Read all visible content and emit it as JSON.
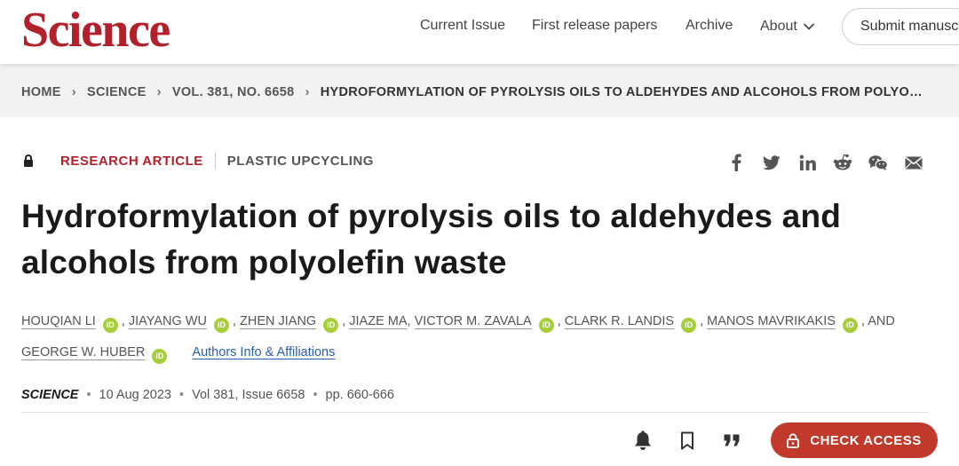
{
  "header": {
    "logo": "Science",
    "nav": [
      "Current Issue",
      "First release papers",
      "Archive",
      "About"
    ],
    "submit_label": "Submit manuscript"
  },
  "breadcrumb": [
    "HOME",
    "SCIENCE",
    "VOL. 381, NO. 6658",
    "HYDROFORMYLATION OF PYROLYSIS OILS TO ALDEHYDES AND ALCOHOLS FROM POLYOLEFIN WASTE"
  ],
  "article": {
    "type": "RESEARCH ARTICLE",
    "topic": "PLASTIC UPCYCLING",
    "title": "Hydroformylation of pyrolysis oils to aldehydes and alcohols from polyolefin waste",
    "authors": [
      "HOUQIAN LI",
      "JIAYANG WU",
      "ZHEN JIANG",
      "JIAZE MA",
      "VICTOR M. ZAVALA",
      "CLARK R. LANDIS",
      "MANOS MAVRIKAKIS",
      "GEORGE W. HUBER"
    ],
    "and_label": "AND",
    "orcid_label": "iD",
    "affiliations_link": "Authors Info & Affiliations",
    "journal": "SCIENCE",
    "date": "10 Aug 2023",
    "volume_issue": "Vol 381, Issue 6658",
    "pages": "pp. 660-666"
  },
  "share_icons": [
    "facebook-icon",
    "twitter-icon",
    "linkedin-icon",
    "reddit-icon",
    "wechat-icon",
    "email-icon"
  ],
  "actions": {
    "check_access": "CHECK ACCESS"
  },
  "colors": {
    "brand": "#b2202c",
    "button": "#c0392b",
    "orcid": "#a6ce39",
    "link": "#2a5db0"
  }
}
